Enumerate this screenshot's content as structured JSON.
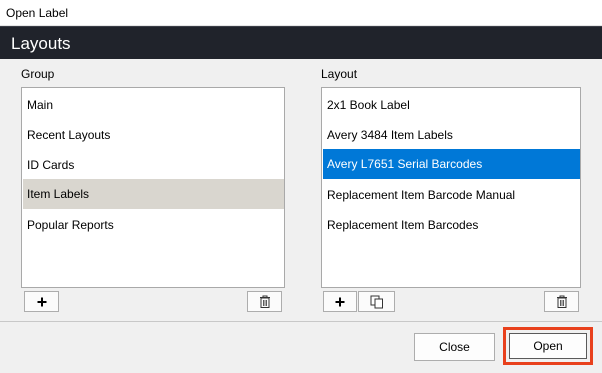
{
  "window": {
    "title": "Open Label"
  },
  "header": {
    "title": "Layouts"
  },
  "group": {
    "label": "Group",
    "items": [
      {
        "label": "Main"
      },
      {
        "label": "Recent Layouts"
      },
      {
        "label": "ID Cards"
      },
      {
        "label": "Item Labels",
        "state": "highlighted"
      },
      {
        "label": "Popular Reports"
      }
    ],
    "buttons": {
      "add_icon": "plus-icon",
      "delete_icon": "trash-icon"
    }
  },
  "layout": {
    "label": "Layout",
    "items": [
      {
        "label": "2x1 Book Label"
      },
      {
        "label": "Avery 3484 Item Labels"
      },
      {
        "label": "Avery L7651 Serial Barcodes",
        "state": "selected"
      },
      {
        "label": "Replacement Item Barcode Manual"
      },
      {
        "label": "Replacement Item Barcodes"
      }
    ],
    "buttons": {
      "add_icon": "plus-icon",
      "copy_icon": "copy-icon",
      "delete_icon": "trash-icon"
    }
  },
  "footer": {
    "close_label": "Close",
    "open_label": "Open"
  },
  "colors": {
    "header_bg": "#20232b",
    "selection": "#0078d7",
    "highlight": "#d9d6cf",
    "callout": "#e8401c"
  }
}
